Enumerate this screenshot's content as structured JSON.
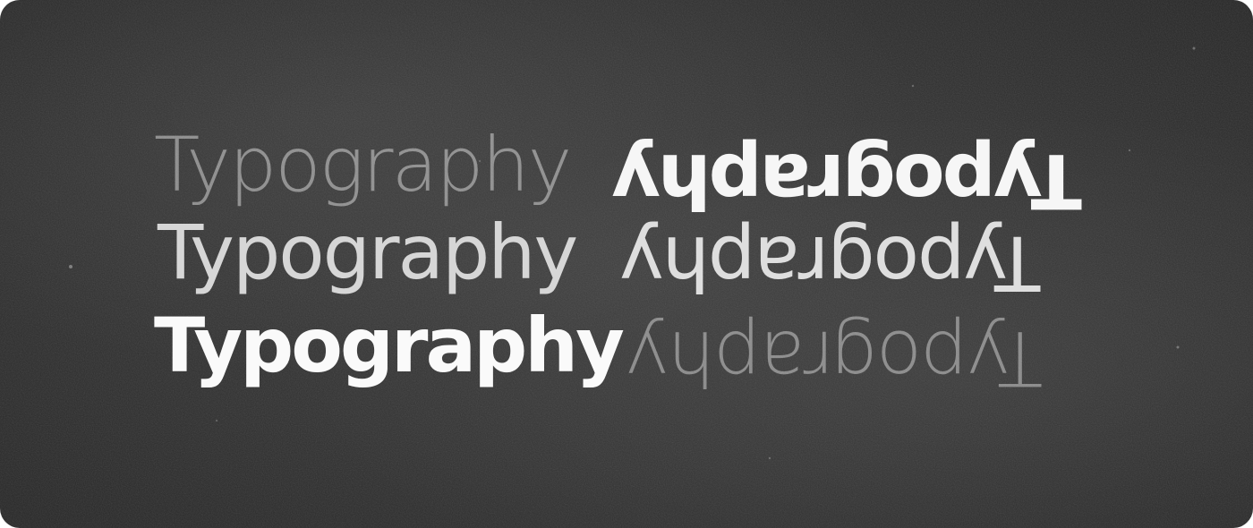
{
  "rows": [
    {
      "left": "Typography",
      "right": "Typography"
    },
    {
      "left": "Typography",
      "right": "Typography"
    },
    {
      "left": "Typography",
      "right": "Typography"
    }
  ],
  "colors": {
    "background": "#303030",
    "text_bright": "#f6f6f6",
    "text_mid": "#d6d6d6",
    "text_dim": "#6b6b6b"
  }
}
